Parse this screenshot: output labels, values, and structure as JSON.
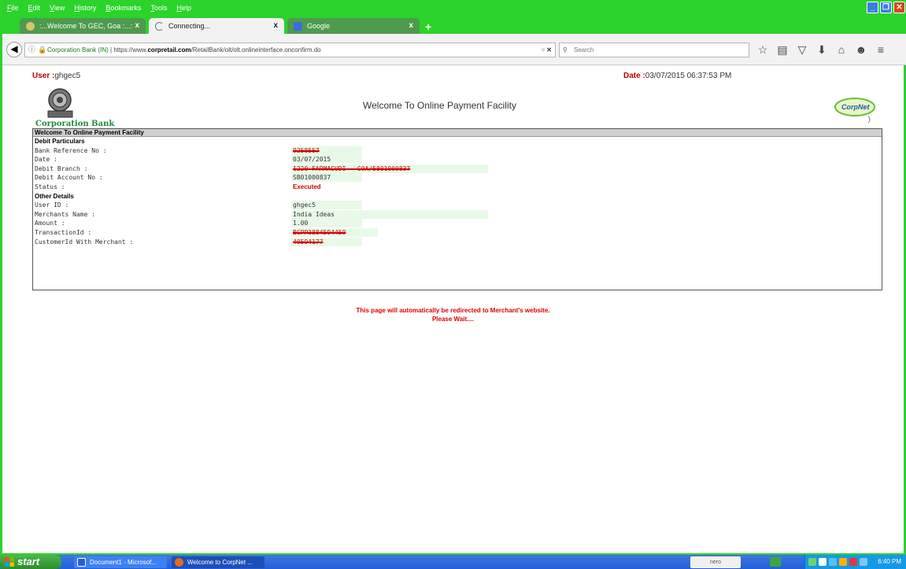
{
  "menubar": {
    "items": [
      "File",
      "Edit",
      "View",
      "History",
      "Bookmarks",
      "Tools",
      "Help"
    ]
  },
  "tabs": [
    {
      "label": ":...Welcome To GEC, Goa :...:",
      "close": "x"
    },
    {
      "label": "Connecting...",
      "close": "x"
    },
    {
      "label": "Google",
      "close": "x"
    }
  ],
  "newtab": "+",
  "navbar": {
    "site_identity": "Corporation Bank (IN)",
    "url_prefix": "https://www.",
    "url_host": "corpretail.com",
    "url_path": "/RetailBank/olt/olt.onlineinterface.onconfirm.do",
    "search_placeholder": "Search"
  },
  "page": {
    "user_label": "User :",
    "user_value": "ghgec5",
    "date_label": "Date :",
    "date_value": "03/07/2015 06:37:53 PM",
    "bank_name": "Corporation Bank",
    "welcome": "Welcome To Online Payment Facility",
    "corpnet_logo": "CorpNet",
    "panel_title": "Welcome To Online Payment Facility",
    "debit_header": "Debit Particulars",
    "debit_rows": [
      {
        "label": "Bank Reference No :",
        "value": "9258557"
      },
      {
        "label": "Date :",
        "value": "03/07/2015"
      },
      {
        "label": "Debit Branch :",
        "value": "1220-FARMAGUDI - GOA/5801000837"
      },
      {
        "label": "Debit Account No :",
        "value": "SB01000837"
      },
      {
        "label": "Status :",
        "value": "Executed"
      }
    ],
    "other_header": "Other Details",
    "other_rows": [
      {
        "label": "User ID :",
        "value": "ghgec5"
      },
      {
        "label": "Merchants Name :",
        "value": "India Ideas"
      },
      {
        "label": "Amount :",
        "value": "1.00"
      },
      {
        "label": "TransactionId :",
        "value": "BCPP3884594459"
      },
      {
        "label": "CustomerId With Merchant :",
        "value": "40594177"
      }
    ],
    "redirect_line1": "This page will automatically be redirected to Merchant's website.",
    "redirect_line2": "Please Wait...."
  },
  "taskbar": {
    "start": "start",
    "tasks": [
      "Document1 - Microsof...",
      "Welcome to CorpNet ..."
    ],
    "nero": "nero",
    "time": "6:40 PM"
  },
  "colors": {
    "chrome_green": "#2bd32b",
    "label_red": "#c00000",
    "bank_green": "#1e8a3a",
    "value_bg": "#e8f9e8"
  }
}
